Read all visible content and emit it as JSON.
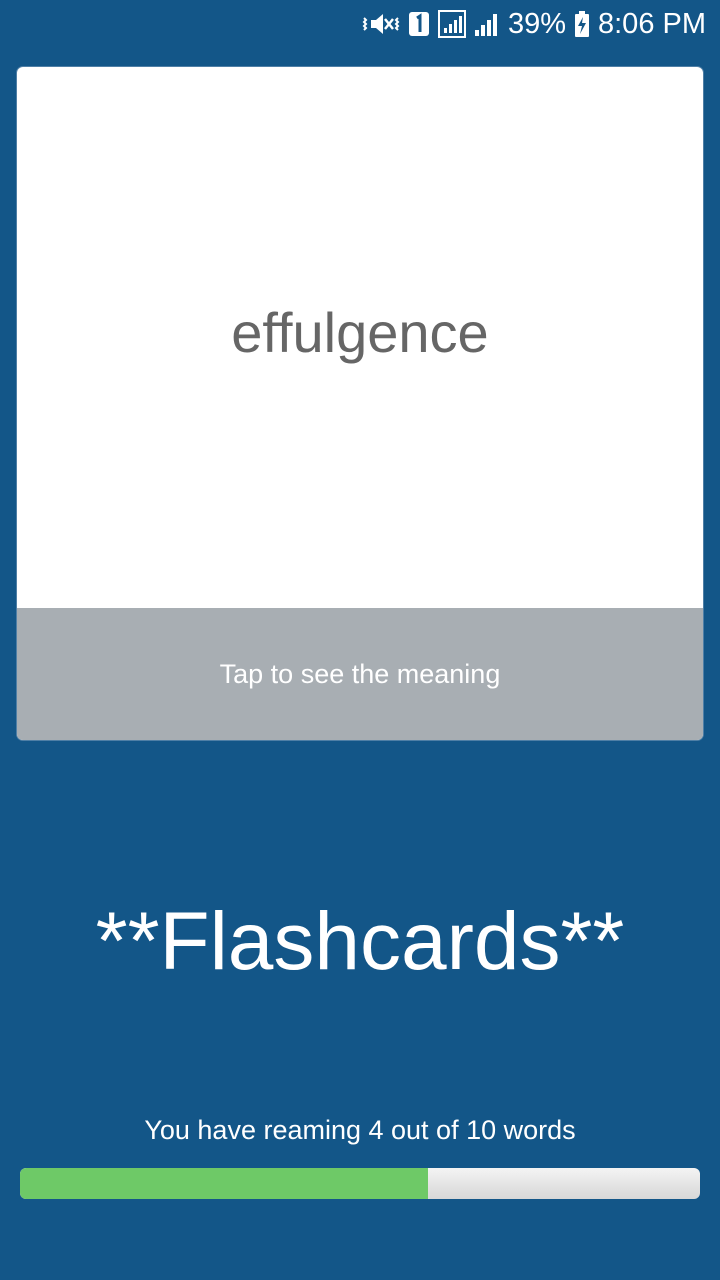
{
  "status_bar": {
    "icons": [
      "vibrate-mute-icon",
      "sim-1-icon",
      "signal-sim1-icon",
      "signal-sim2-icon"
    ],
    "battery_percent": "39%",
    "battery_icon": "battery-charging-icon",
    "time": "8:06 PM"
  },
  "card": {
    "word": "effulgence",
    "hint": "Tap to see the meaning"
  },
  "app_title": "**Flashcards**",
  "progress": {
    "text": "You have reaming 4 out of 10 words",
    "remaining": 4,
    "total": 10,
    "fill_fraction": 0.6
  },
  "colors": {
    "background": "#135688",
    "card": "#ffffff",
    "card_footer": "#a8aeb3",
    "word_text": "#666666",
    "progress_fill": "#6ec967",
    "progress_track": "#e2e2e2"
  }
}
